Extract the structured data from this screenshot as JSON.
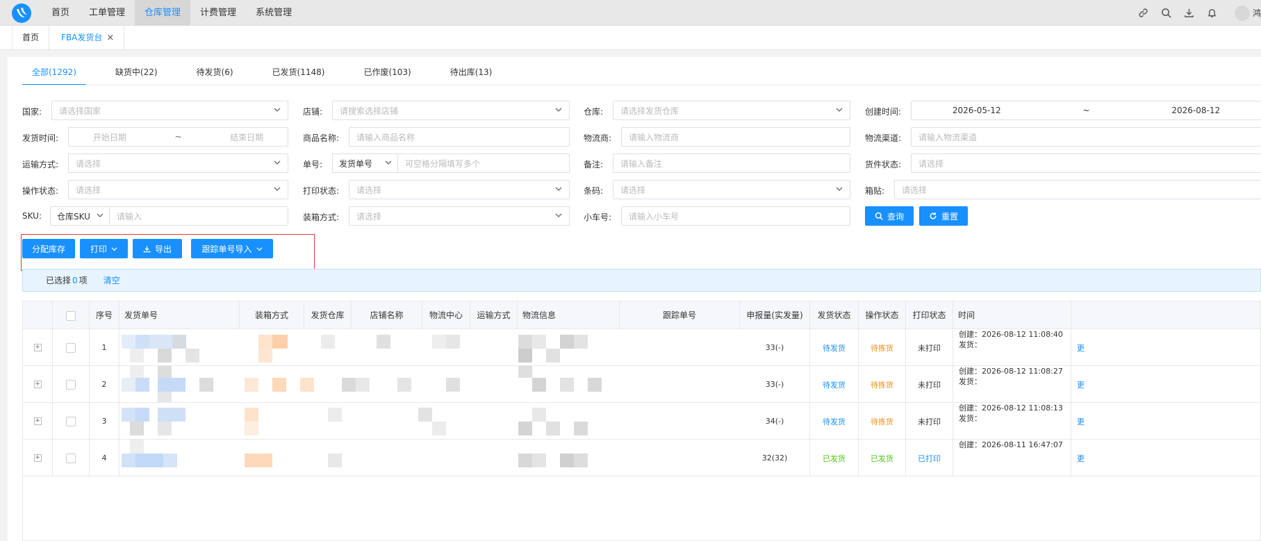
{
  "topnav": {
    "items": [
      "首页",
      "工单管理",
      "仓库管理",
      "计费管理",
      "系统管理"
    ],
    "active_index": 2,
    "username": "鸿展"
  },
  "page_tabs": [
    {
      "label": "首页"
    },
    {
      "label": "FBA发货台",
      "closable": true
    }
  ],
  "status_tabs": [
    "全部(1292)",
    "缺货中(22)",
    "待发货(6)",
    "已发货(1148)",
    "已作废(103)",
    "待出库(13)"
  ],
  "filters": {
    "country": {
      "label": "国家:",
      "placeholder": "请选择国家"
    },
    "shop": {
      "label": "店铺:",
      "placeholder": "请搜索选择店铺"
    },
    "warehouse": {
      "label": "仓库:",
      "placeholder": "请选择发货仓库"
    },
    "create_time": {
      "label": "创建时间:",
      "start": "2026-05-12",
      "sep": "~",
      "end": "2026-08-12"
    },
    "ship_time": {
      "label": "发货时间:",
      "start": "开始日期",
      "sep": "~",
      "end": "结束日期"
    },
    "product_name": {
      "label": "商品名称:",
      "placeholder": "请输入商品名称"
    },
    "carrier": {
      "label": "物流商:",
      "placeholder": "请输入物流商"
    },
    "channel": {
      "label": "物流渠道:",
      "placeholder": "请输入物流渠道"
    },
    "transport": {
      "label": "运输方式:",
      "placeholder": "请选择"
    },
    "order_no": {
      "label": "单号:",
      "type_value": "发货单号",
      "placeholder": "可空格分隔填写多个"
    },
    "remark": {
      "label": "备注:",
      "placeholder": "请输入备注"
    },
    "cargo_status": {
      "label": "货件状态:",
      "placeholder": "请选择"
    },
    "op_status": {
      "label": "操作状态:",
      "placeholder": "请选择"
    },
    "print_status": {
      "label": "打印状态:",
      "placeholder": "请选择"
    },
    "barcode": {
      "label": "条码:",
      "placeholder": "请选择"
    },
    "box_label": {
      "label": "箱贴:",
      "placeholder": "请选择"
    },
    "sku": {
      "label": "SKU:",
      "type_value": "仓库SKU",
      "placeholder": "请输入"
    },
    "packing": {
      "label": "装箱方式:",
      "placeholder": "请选择"
    },
    "cart_no": {
      "label": "小车号:",
      "placeholder": "请输入小车号"
    }
  },
  "buttons": {
    "query": "查询",
    "reset": "重置",
    "allocate": "分配库存",
    "print": "打印",
    "export": "导出",
    "tracking_import": "跟踪单号导入"
  },
  "selection": {
    "prefix": "已选择",
    "count": "0",
    "suffix": "项",
    "clear": "清空"
  },
  "table": {
    "headers": [
      "序号",
      "发货单号",
      "装箱方式",
      "发货仓库",
      "店铺名称",
      "物流中心",
      "运输方式",
      "物流信息",
      "跟踪单号",
      "申报量(实发量)",
      "发货状态",
      "操作状态",
      "打印状态",
      "时间"
    ],
    "rows": [
      {
        "seq": "1",
        "qty": "33(-)",
        "ship_status": "待发货",
        "op_status": "待拣货",
        "print_status": "未打印",
        "created": "创建：2026-08-12 11:08:40",
        "shipped": "发货：",
        "action": "更"
      },
      {
        "seq": "2",
        "qty": "33(-)",
        "ship_status": "待发货",
        "op_status": "待拣货",
        "print_status": "未打印",
        "created": "创建：2026-08-12 11:08:27",
        "shipped": "发货：",
        "action": "更"
      },
      {
        "seq": "3",
        "qty": "34(-)",
        "ship_status": "待发货",
        "op_status": "待拣货",
        "print_status": "未打印",
        "created": "创建：2026-08-12 11:08:13",
        "shipped": "发货：",
        "action": "更"
      },
      {
        "seq": "4",
        "qty": "32(32)",
        "ship_status": "已发货",
        "op_status": "已发货",
        "print_status": "已打印",
        "created": "创建：2026-08-11 16:47:07",
        "shipped": "",
        "action": "更"
      }
    ]
  },
  "colors": {
    "primary": "#1890ff",
    "pending": "#1890ff",
    "picking": "#fa8c16",
    "done": "#52c41a",
    "highlight_border": "#e53935"
  }
}
